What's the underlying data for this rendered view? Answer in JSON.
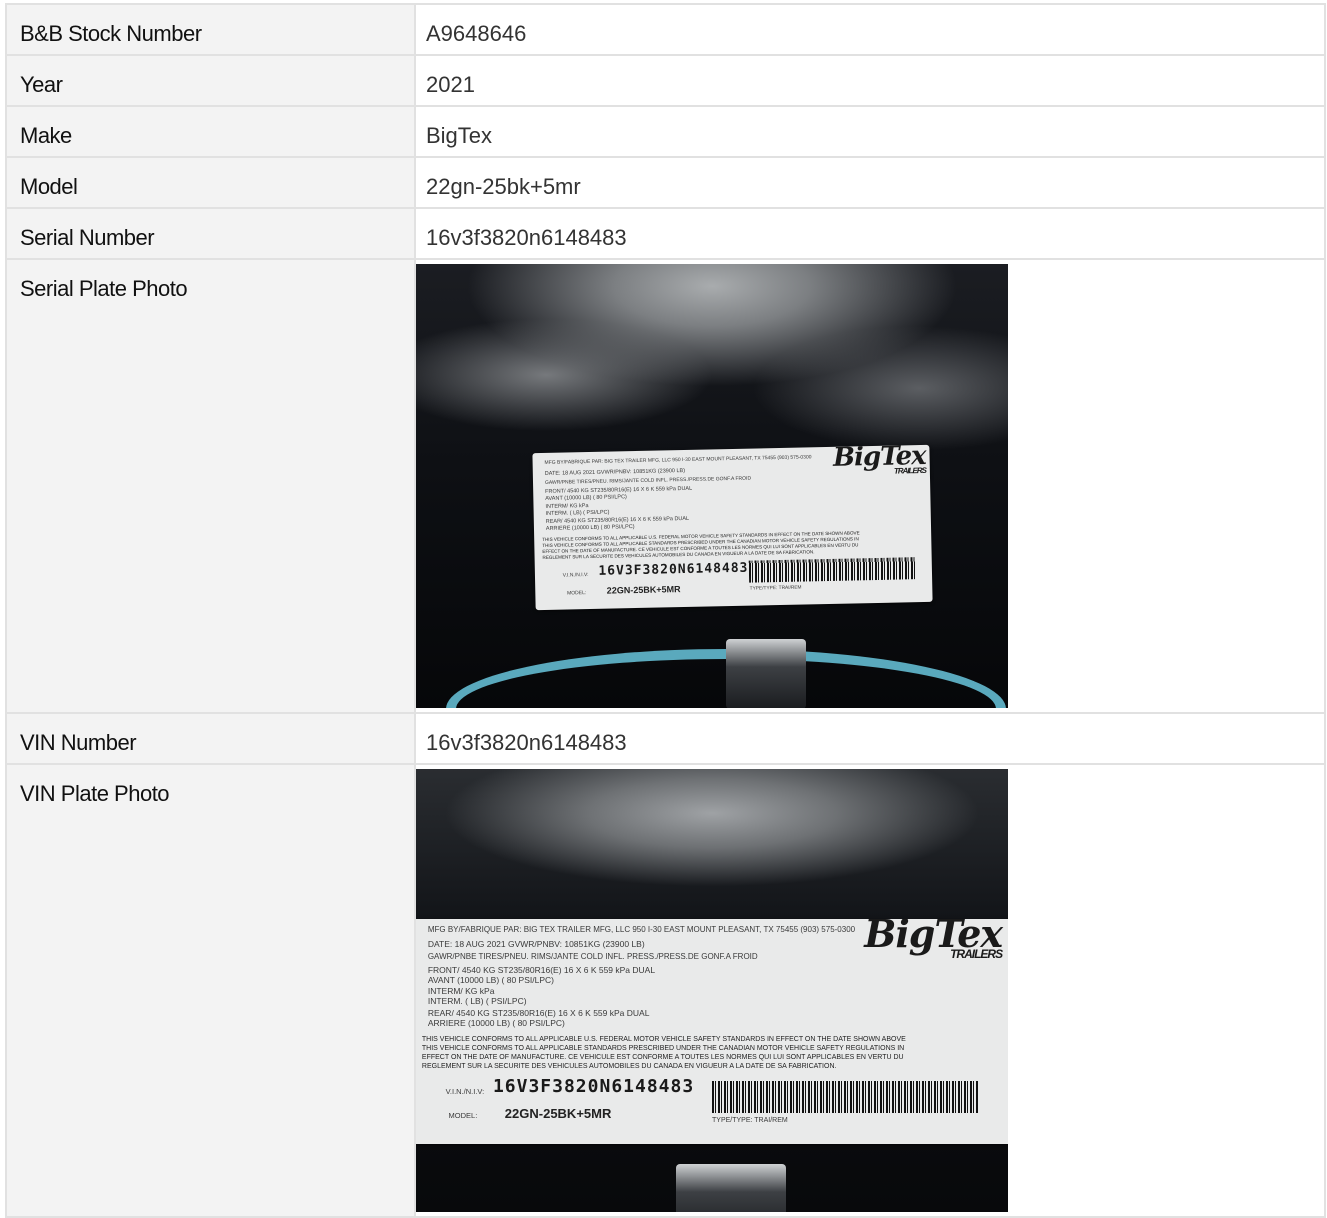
{
  "rows": [
    {
      "label": "B&B Stock Number",
      "value": "A9648646"
    },
    {
      "label": "Year",
      "value": "2021"
    },
    {
      "label": "Make",
      "value": "BigTex"
    },
    {
      "label": "Model",
      "value": "22gn-25bk+5mr"
    },
    {
      "label": "Serial Number",
      "value": "16v3f3820n6148483"
    },
    {
      "label": "Serial Plate Photo"
    },
    {
      "label": "VIN Number",
      "value": "16v3f3820n6148483"
    },
    {
      "label": "VIN Plate Photo"
    }
  ],
  "plate": {
    "brand": "BigTex",
    "brand_sub": "TRAILERS",
    "mfg_line": "MFG BY/FABRIQUE PAR:   BIG TEX TRAILER MFG, LLC   950 I-30 EAST   MOUNT PLEASANT, TX 75455   (903) 575-0300",
    "date_line": "DATE:  18 AUG 2021  GVWR/PNBV:   10851KG (23900  LB)",
    "header_line": "GAWR/PNBE          TIRES/PNEU.                    RIMS/JANTE    COLD INFL. PRESS./PRESS.DE GONF.A FROID",
    "front_line": "FRONT/   4540   KG   ST235/80R16(E)          16 X 6 K               559  kPa   DUAL",
    "avant_line": "AVANT   (10000   LB)                                                 (  80  PSI/LPC)",
    "interm_line": "INTERM/           KG                                                          kPa",
    "interm2_line": "INTERM.  (         LB)                                                (      PSI/LPC)",
    "rear_line": "REAR/    4540   KG   ST235/80R16(E)          16 X 6 K               559  kPa   DUAL",
    "arriere_line": "ARRIERE (10000   LB)                                                 (  80  PSI/LPC)",
    "conform_1": "THIS VEHICLE CONFORMS TO ALL APPLICABLE U.S. FEDERAL MOTOR VEHICLE SAFETY STANDARDS IN EFFECT ON THE DATE SHOWN ABOVE",
    "conform_2": "THIS VEHICLE CONFORMS TO ALL APPLICABLE STANDARDS PRESCRIBED UNDER THE CANADIAN MOTOR VEHICLE SAFETY REGULATIONS IN",
    "conform_3": "EFFECT ON THE DATE OF MANUFACTURE.  CE VEHICULE EST CONFORME A TOUTES LES NORMES QUI LUI SONT APPLICABLES EN VERTU DU",
    "conform_4": "REGLEMENT SUR LA SECURITE DES VEHICULES AUTOMOBILES DU CANADA EN VIGUEUR A LA DATE DE SA FABRICATION.",
    "vin_label": "V.I.N./N.I.V:",
    "vin": "16V3F3820N6148483",
    "model_label": "MODEL:",
    "model": "22GN-25BK+5MR",
    "type_line": "TYPE/TYPE: TRAI/REM"
  },
  "colors": {
    "label_bg": "#f3f3f3",
    "border": "#e1e1e1",
    "hose": "#5aa9bd"
  }
}
